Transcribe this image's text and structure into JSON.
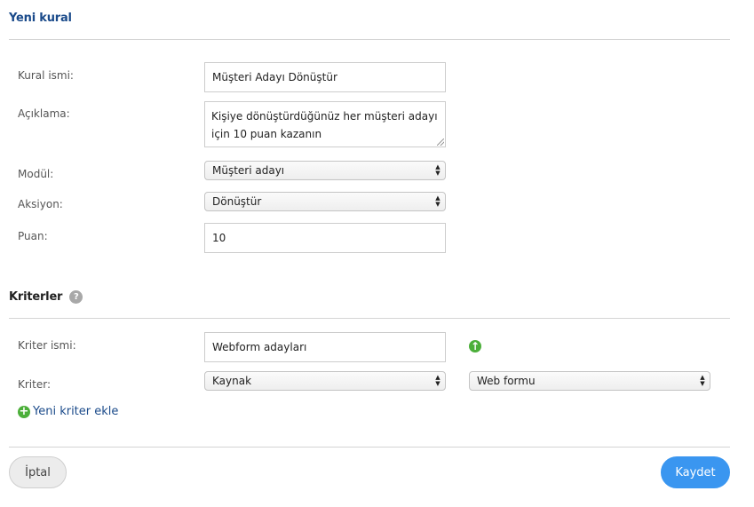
{
  "header": {
    "title": "Yeni kural"
  },
  "form": {
    "rule_name": {
      "label": "Kural ismi:",
      "value": "Müşteri Adayı Dönüştür"
    },
    "description": {
      "label": "Açıklama:",
      "value": "Kişiye dönüştürdüğünüz her müşteri adayı için 10 puan kazanın"
    },
    "module": {
      "label": "Modül:",
      "value": "Müşteri adayı"
    },
    "action": {
      "label": "Aksiyon:",
      "value": "Dönüştür"
    },
    "points": {
      "label": "Puan:",
      "value": "10"
    }
  },
  "criteria": {
    "title": "Kriterler",
    "help_glyph": "?",
    "name": {
      "label": "Kriter ismi:",
      "value": "Webform adayları"
    },
    "criterion": {
      "label": "Kriter:",
      "field_value": "Kaynak",
      "value_value": "Web formu"
    },
    "add_label": "Yeni kriter ekle"
  },
  "footer": {
    "cancel_label": "İptal",
    "save_label": "Kaydet"
  },
  "icons": {
    "help": "question-circle-icon",
    "up": "arrow-up-circle-icon",
    "add": "plus-circle-icon",
    "select_arrows": "up-down-arrows-icon"
  },
  "colors": {
    "title": "#1a4a8a",
    "link": "#1a4a8a",
    "green": "#4caf3a",
    "primary": "#3a96f0",
    "border": "#cccccc"
  }
}
